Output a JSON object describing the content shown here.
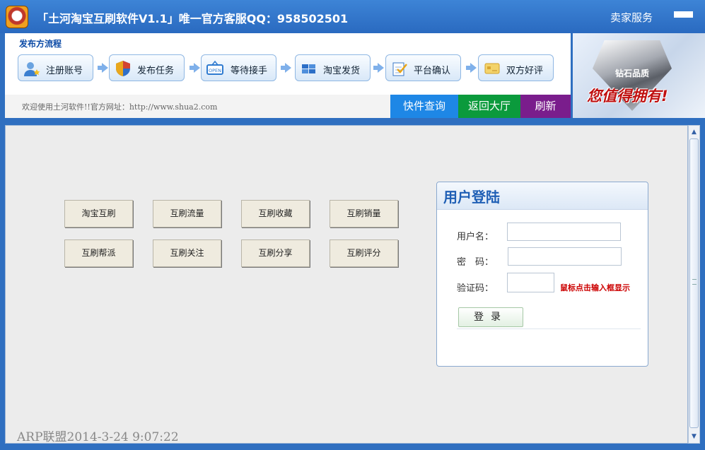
{
  "window": {
    "title": "「土河淘宝互刷软件V1.1」唯一官方客服QQ：958502501",
    "seller_service": "卖家服务"
  },
  "flow": {
    "title": "发布方流程",
    "steps": [
      {
        "label": "注册账号",
        "icon": "user-icon"
      },
      {
        "label": "发布任务",
        "icon": "shield-icon"
      },
      {
        "label": "等待接手",
        "icon": "open-sign-icon"
      },
      {
        "label": "淘宝发货",
        "icon": "package-icon"
      },
      {
        "label": "平台确认",
        "icon": "checklist-icon"
      },
      {
        "label": "双方好评",
        "icon": "card-icon"
      }
    ]
  },
  "welcome_text": "欢迎使用土河软件!!官方网址：http://www.shua2.com",
  "nav": {
    "express_query": "快件查询",
    "back_hall": "返回大厅",
    "refresh": "刷新",
    "colors": {
      "express": "#1e87e6",
      "hall": "#0b9a3c",
      "refresh": "#7a1d8c"
    }
  },
  "banner": {
    "gem_label": "钻石品质",
    "slogan": "您值得拥有!"
  },
  "features": [
    [
      "淘宝互刷",
      "互刷流量",
      "互刷收藏",
      "互刷销量"
    ],
    [
      "互刷帮派",
      "互刷关注",
      "互刷分享",
      "互刷评分"
    ]
  ],
  "login": {
    "title": "用户登陆",
    "username_label": "用户名：",
    "password_label": "密　码：",
    "captcha_label": "验证码：",
    "captcha_hint": "鼠标点击输入框显示",
    "submit": "登录"
  },
  "status": "ARP联盟2014-3-24 9:07:22"
}
